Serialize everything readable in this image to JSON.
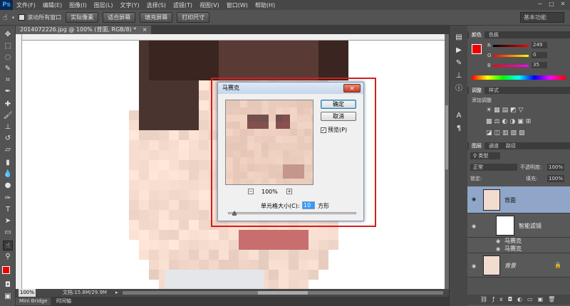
{
  "menubar": {
    "logo": "Ps",
    "items": [
      "文件(F)",
      "编辑(E)",
      "图像(I)",
      "图层(L)",
      "文字(Y)",
      "选择(S)",
      "滤镜(T)",
      "视图(V)",
      "窗口(W)",
      "帮助(H)"
    ]
  },
  "options": {
    "scroll_all_label": "滚动所有窗口",
    "buttons": [
      "实际像素",
      "适合屏幕",
      "填充屏幕",
      "打印尺寸"
    ],
    "workspace": "基本功能"
  },
  "document": {
    "tab_title": "2014072226.jpg @ 100% (背面, RGB/8) *",
    "zoom": "100%",
    "doc_size": "文档:15.8M/29.9M"
  },
  "bottom_tabs": [
    "Mini Bridge",
    "时间轴"
  ],
  "panels": {
    "color_tabs": [
      "颜色",
      "色板"
    ],
    "color_values": {
      "r": "249",
      "g": "0",
      "b": "35"
    },
    "adjust_tabs": [
      "调整",
      "样式"
    ],
    "adjust_title": "添加调整",
    "layer_tabs": [
      "图层",
      "通道",
      "路径"
    ],
    "layer_kind": "类型",
    "blend_mode": "正常",
    "opacity_label": "不透明度:",
    "opacity_value": "100%",
    "lock_label": "锁定:",
    "fill_label": "填充:",
    "fill_value": "100%",
    "layers": [
      {
        "name": "背面"
      },
      {
        "name": "智能滤镜"
      },
      {
        "name": "马赛克"
      },
      {
        "name": "马赛克"
      },
      {
        "name": "背景"
      }
    ]
  },
  "dialog": {
    "title": "马赛克",
    "ok": "确定",
    "cancel": "取消",
    "preview_label": "预览(P)",
    "zoom": "100%",
    "cell_size_label": "单元格大小(C):",
    "cell_size_value": "10",
    "unit": "方形"
  },
  "colors": {
    "foreground": "#ee0000",
    "highlight": "#d21e1e"
  }
}
